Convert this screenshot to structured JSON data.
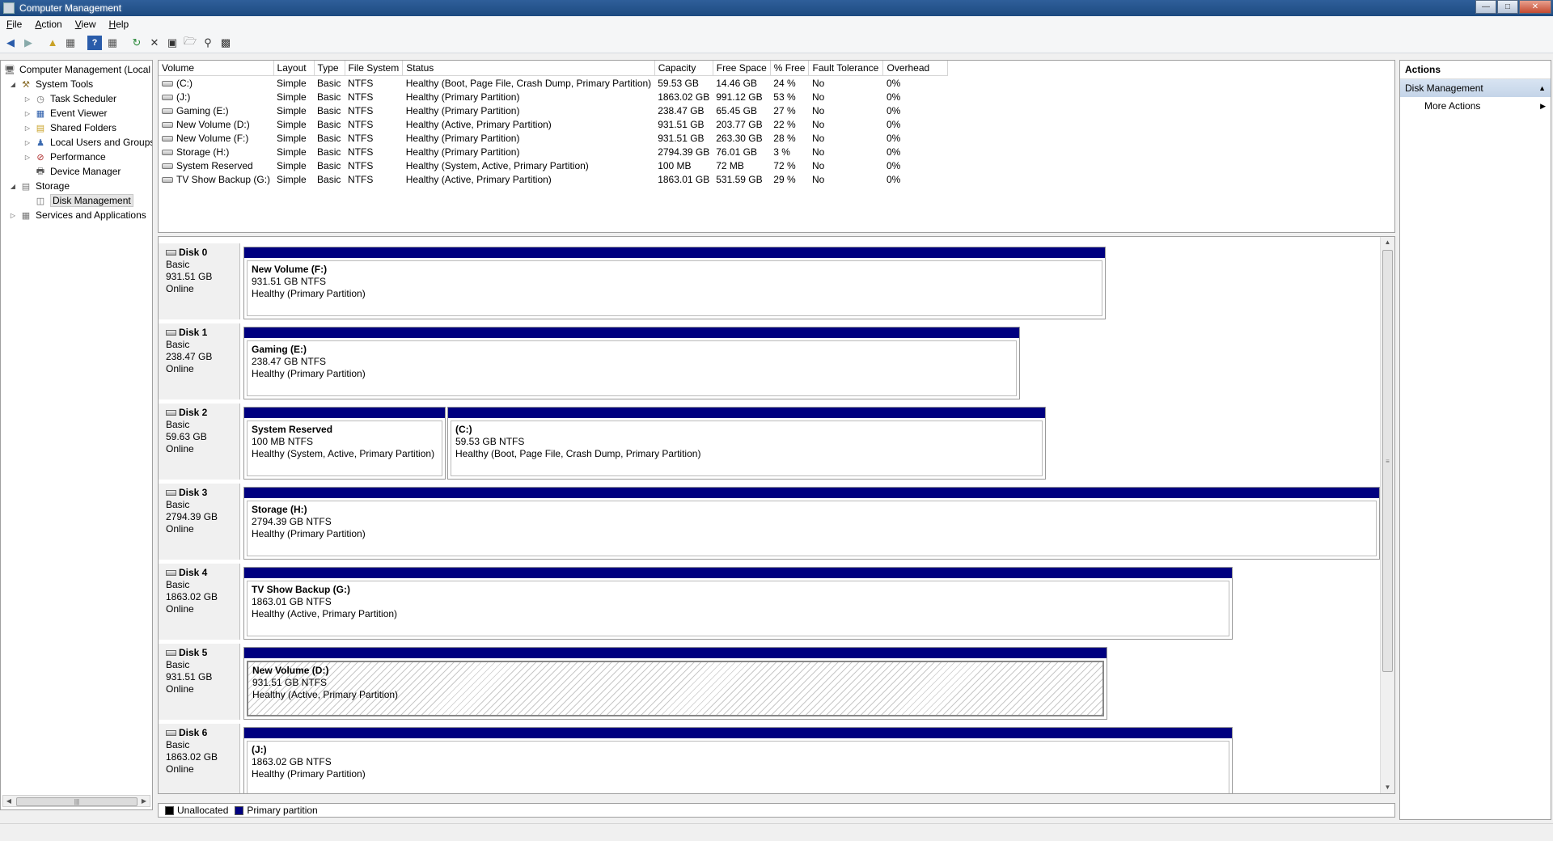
{
  "window": {
    "title": "Computer Management"
  },
  "menu": [
    {
      "label": "File",
      "key": "F",
      "rest": "ile"
    },
    {
      "label": "Action",
      "key": "A",
      "rest": "ction"
    },
    {
      "label": "View",
      "key": "V",
      "rest": "iew"
    },
    {
      "label": "Help",
      "key": "H",
      "rest": "elp"
    }
  ],
  "tree": {
    "root": "Computer Management (Local",
    "system_tools": "System Tools",
    "task_scheduler": "Task Scheduler",
    "event_viewer": "Event Viewer",
    "shared_folders": "Shared Folders",
    "local_users": "Local Users and Groups",
    "performance": "Performance",
    "device_manager": "Device Manager",
    "storage": "Storage",
    "disk_management": "Disk Management",
    "services": "Services and Applications"
  },
  "volumes": {
    "headers": [
      "Volume",
      "Layout",
      "Type",
      "File System",
      "Status",
      "Capacity",
      "Free Space",
      "% Free",
      "Fault Tolerance",
      "Overhead"
    ],
    "rows": [
      [
        "(C:)",
        "Simple",
        "Basic",
        "NTFS",
        "Healthy (Boot, Page File, Crash Dump, Primary Partition)",
        "59.53 GB",
        "14.46 GB",
        "24 %",
        "No",
        "0%"
      ],
      [
        "(J:)",
        "Simple",
        "Basic",
        "NTFS",
        "Healthy (Primary Partition)",
        "1863.02 GB",
        "991.12 GB",
        "53 %",
        "No",
        "0%"
      ],
      [
        "Gaming (E:)",
        "Simple",
        "Basic",
        "NTFS",
        "Healthy (Primary Partition)",
        "238.47 GB",
        "65.45 GB",
        "27 %",
        "No",
        "0%"
      ],
      [
        "New Volume (D:)",
        "Simple",
        "Basic",
        "NTFS",
        "Healthy (Active, Primary Partition)",
        "931.51 GB",
        "203.77 GB",
        "22 %",
        "No",
        "0%"
      ],
      [
        "New Volume (F:)",
        "Simple",
        "Basic",
        "NTFS",
        "Healthy (Primary Partition)",
        "931.51 GB",
        "263.30 GB",
        "28 %",
        "No",
        "0%"
      ],
      [
        "Storage (H:)",
        "Simple",
        "Basic",
        "NTFS",
        "Healthy (Primary Partition)",
        "2794.39 GB",
        "76.01 GB",
        "3 %",
        "No",
        "0%"
      ],
      [
        "System Reserved",
        "Simple",
        "Basic",
        "NTFS",
        "Healthy (System, Active, Primary Partition)",
        "100 MB",
        "72 MB",
        "72 %",
        "No",
        "0%"
      ],
      [
        "TV Show Backup (G:)",
        "Simple",
        "Basic",
        "NTFS",
        "Healthy (Active, Primary Partition)",
        "1863.01 GB",
        "531.59 GB",
        "29 %",
        "No",
        "0%"
      ]
    ]
  },
  "disks": [
    {
      "name": "Disk 0",
      "type": "Basic",
      "size": "931.51 GB",
      "status": "Online",
      "partitions": [
        {
          "name": "New Volume  (F:)",
          "size": "931.51 GB NTFS",
          "status": "Healthy (Primary Partition)"
        }
      ]
    },
    {
      "name": "Disk 1",
      "type": "Basic",
      "size": "238.47 GB",
      "status": "Online",
      "partitions": [
        {
          "name": "Gaming  (E:)",
          "size": "238.47 GB NTFS",
          "status": "Healthy (Primary Partition)"
        }
      ]
    },
    {
      "name": "Disk 2",
      "type": "Basic",
      "size": "59.63 GB",
      "status": "Online",
      "partitions": [
        {
          "name": "System Reserved",
          "size": "100 MB NTFS",
          "status": "Healthy (System, Active, Primary Partition)"
        },
        {
          "name": "(C:)",
          "size": "59.53 GB NTFS",
          "status": "Healthy (Boot, Page File, Crash Dump, Primary Partition)"
        }
      ]
    },
    {
      "name": "Disk 3",
      "type": "Basic",
      "size": "2794.39 GB",
      "status": "Online",
      "partitions": [
        {
          "name": "Storage  (H:)",
          "size": "2794.39 GB NTFS",
          "status": "Healthy (Primary Partition)"
        }
      ]
    },
    {
      "name": "Disk 4",
      "type": "Basic",
      "size": "1863.02 GB",
      "status": "Online",
      "partitions": [
        {
          "name": "TV Show Backup  (G:)",
          "size": "1863.01 GB NTFS",
          "status": "Healthy (Active, Primary Partition)"
        }
      ]
    },
    {
      "name": "Disk 5",
      "type": "Basic",
      "size": "931.51 GB",
      "status": "Online",
      "partitions": [
        {
          "name": "New Volume  (D:)",
          "size": "931.51 GB NTFS",
          "status": "Healthy (Active, Primary Partition)"
        }
      ]
    },
    {
      "name": "Disk 6",
      "type": "Basic",
      "size": "1863.02 GB",
      "status": "Online",
      "partitions": [
        {
          "name": "(J:)",
          "size": "1863.02 GB NTFS",
          "status": "Healthy (Primary Partition)"
        }
      ]
    }
  ],
  "legend": {
    "unallocated": "Unallocated",
    "primary": "Primary partition",
    "unallocated_color": "#000000",
    "primary_color": "#000080"
  },
  "actions": {
    "header": "Actions",
    "section": "Disk Management",
    "more": "More Actions"
  }
}
